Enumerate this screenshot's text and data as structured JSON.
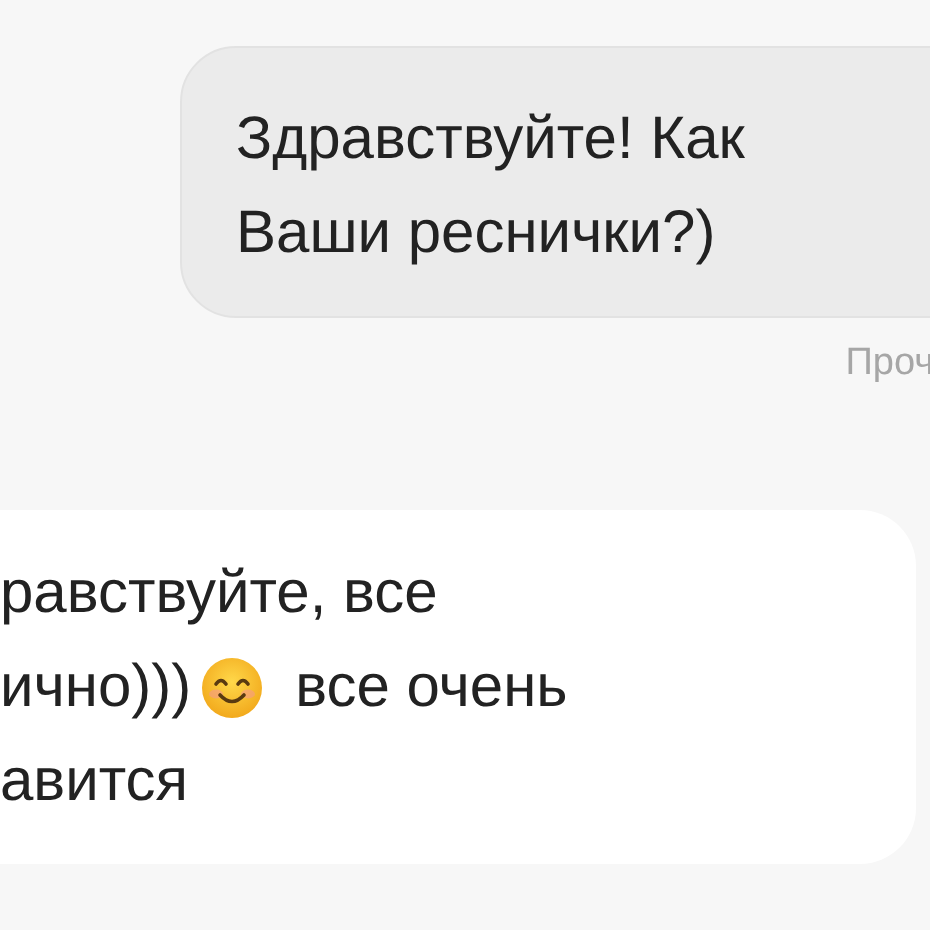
{
  "messages": [
    {
      "kind": "outgoing",
      "lines": [
        [
          {
            "kind": "text",
            "text": "Здравствуйте! Как"
          }
        ],
        [
          {
            "kind": "text",
            "text": "Ваши реснички?)"
          }
        ]
      ],
      "status": "Проч"
    },
    {
      "kind": "incoming",
      "lines": [
        [
          {
            "kind": "text",
            "text": "равствуйте, все"
          }
        ],
        [
          {
            "kind": "text",
            "text": "ично)))"
          },
          {
            "kind": "emoji"
          },
          {
            "kind": "text",
            "text": "все очень"
          }
        ],
        [
          {
            "kind": "text",
            "text": "авится"
          }
        ]
      ]
    }
  ]
}
